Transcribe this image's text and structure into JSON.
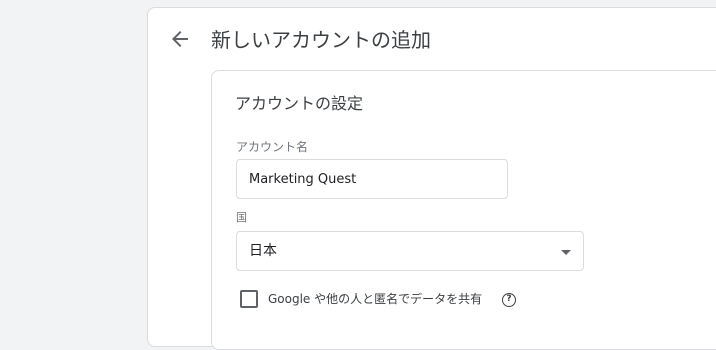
{
  "header": {
    "title": "新しいアカウントの追加",
    "back_icon": "arrow-back-icon"
  },
  "account_settings": {
    "section_title": "アカウントの設定",
    "account_name": {
      "label": "アカウント名",
      "value": "Marketing Quest"
    },
    "country": {
      "label": "国",
      "selected": "日本"
    },
    "share_data": {
      "label": "Google や他の人と匿名でデータを共有",
      "checked": false,
      "help_icon": "help-icon",
      "help_glyph": "?"
    }
  },
  "colors": {
    "page_background": "#f1f3f4",
    "card_border": "#dadce0",
    "text_primary": "#202124",
    "text_secondary": "#70757a"
  }
}
